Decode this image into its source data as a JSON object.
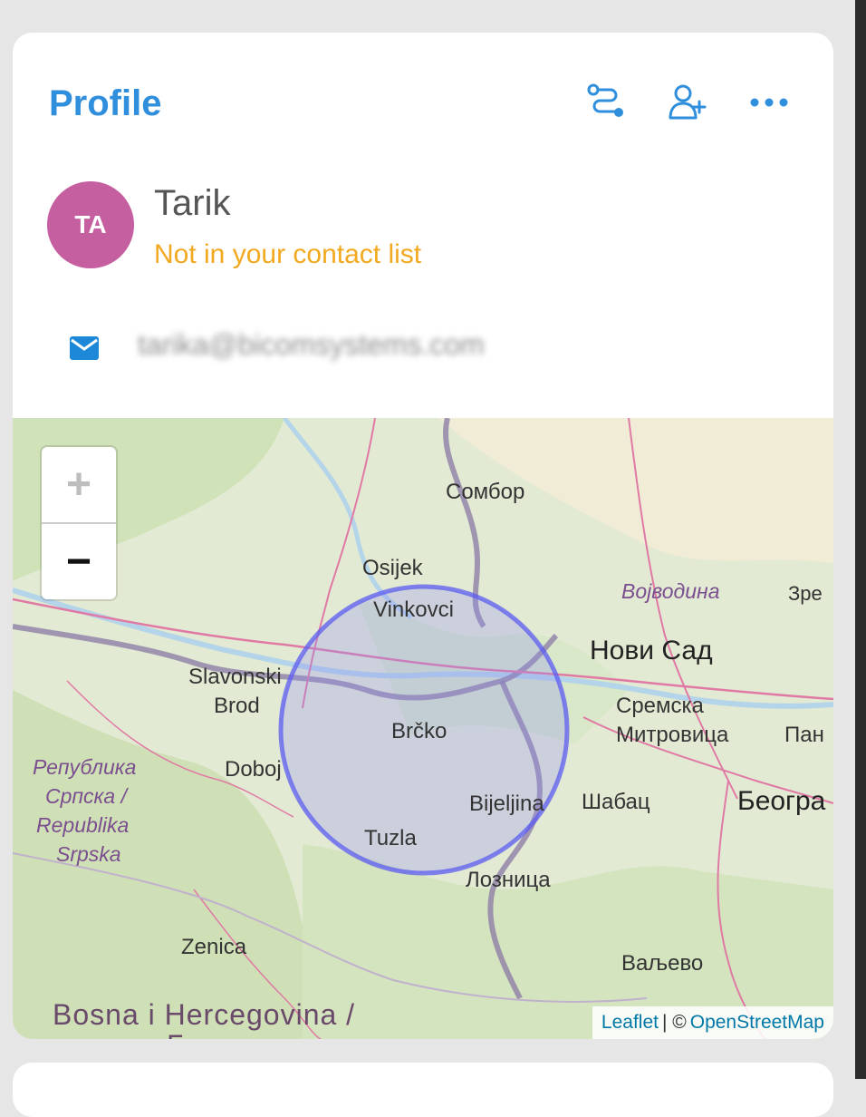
{
  "profile": {
    "title": "Profile",
    "toolbar": {
      "route_icon": "route-icon",
      "add_contact_icon": "add-user-icon",
      "more_icon": "more-dots-icon"
    },
    "user": {
      "initials": "TA",
      "name": "Tarik",
      "status": "Not in your contact list",
      "email": "tarika@bicomsystems.com"
    }
  },
  "map": {
    "zoom_in": "+",
    "zoom_out": "−",
    "labels": {
      "sombor": "Сомбор",
      "osijek": "Osijek",
      "vojvodina": "Војводина",
      "zre": "Зре",
      "vinkovci": "Vinkovci",
      "novi_sad": "Нови Сад",
      "slavonski": "Slavonski",
      "brod": "Brod",
      "sremska": "Сремска",
      "mitrovica": "Митровица",
      "pan": "Пан",
      "brcko": "Brčko",
      "rs1": "Република",
      "rs2": "Српска /",
      "rs3": "Republika",
      "rs4": "Srpska",
      "doboj": "Doboj",
      "bijeljina": "Bijeljina",
      "sabac": "Шабац",
      "beograd": "Београ",
      "tuzla": "Tuzla",
      "loznica": "Лозница",
      "zenica": "Zenica",
      "valjevo": "Ваљево",
      "bih1": "Bosna i Hercegovina /",
      "bih2": "Босна и"
    },
    "attribution": {
      "leaflet": "Leaflet",
      "separator": "| ©",
      "osm": "OpenStreetMap"
    }
  },
  "colors": {
    "accent": "#2f8fdc",
    "avatar": "#c65f9f",
    "status": "#f2a91f",
    "circle": "#5c5cf0"
  }
}
